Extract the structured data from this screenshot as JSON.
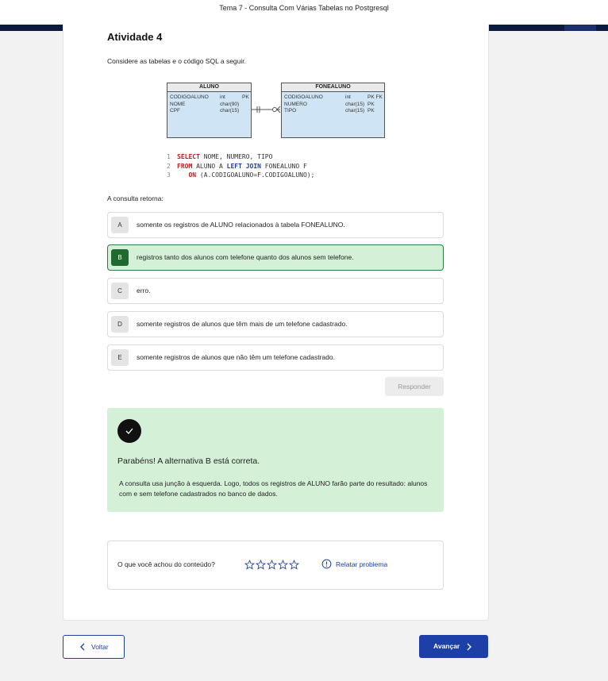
{
  "header": {
    "title": "Tema 7 - Consulta Com Várias Tabelas no Postgresql"
  },
  "activity": {
    "title": "Atividade 4",
    "intro": "Considere as tabelas e o código SQL a seguir.",
    "question": "A consulta retorna:"
  },
  "diagram": {
    "tables": [
      {
        "name": "ALUNO",
        "rows": [
          {
            "field": "CODIGOALUNO",
            "type": "int",
            "key": "PK"
          },
          {
            "field": "NOME",
            "type": "char(90)",
            "key": ""
          },
          {
            "field": "CPF",
            "type": "char(15)",
            "key": ""
          }
        ]
      },
      {
        "name": "FONEALUNO",
        "rows": [
          {
            "field": "CODIGOALUNO",
            "type": "int",
            "key": "PK FK"
          },
          {
            "field": "NUMERO",
            "type": "char(15)",
            "key": "PK"
          },
          {
            "field": "TIPO",
            "type": "char(15)",
            "key": "PK"
          }
        ]
      }
    ]
  },
  "code": {
    "lines": [
      {
        "num": "1",
        "kw1": "SELECT",
        "kw2": "",
        "rest": " NOME, NUMERO, TIPO",
        "indent": ""
      },
      {
        "num": "2",
        "kw1": "FROM",
        "kw2": "LEFT JOIN",
        "mid": " ALUNO A ",
        "rest": " FONEALUNO F",
        "indent": ""
      },
      {
        "num": "3",
        "kw1": "ON",
        "kw2": "",
        "rest": " (A.CODIGOALUNO=F.CODIGOALUNO);",
        "indent": "   "
      }
    ]
  },
  "options": [
    {
      "letter": "A",
      "text": "somente os registros de ALUNO relacionados à tabela FONEALUNO.",
      "selected": false
    },
    {
      "letter": "B",
      "text": "registros tanto dos alunos com telefone quanto dos alunos sem telefone.",
      "selected": true
    },
    {
      "letter": "C",
      "text": "erro.",
      "selected": false
    },
    {
      "letter": "D",
      "text": "somente registros de alunos que têm mais de um telefone cadastrado.",
      "selected": false
    },
    {
      "letter": "E",
      "text": "somente registros de alunos que não têm um telefone cadastrado.",
      "selected": false
    }
  ],
  "respond_label": "Responder",
  "feedback": {
    "icon": "check-icon",
    "title": "Parabéns! A alternativa B está correta.",
    "text": "A consulta usa junção à esquerda. Logo, todos os registros de ALUNO farão parte do resultado: alunos com e sem telefone cadastrados no banco de dados."
  },
  "rating": {
    "label": "O que você achou do conteúdo?",
    "stars": 5,
    "report_label": "Relatar problema"
  },
  "nav": {
    "back_label": "Voltar",
    "next_label": "Avançar"
  },
  "colors": {
    "primary": "#1c3fa8",
    "success_bg": "#d4f1d8",
    "success_dark": "#1f6b2f",
    "header_bar": "#0d1a3f"
  }
}
